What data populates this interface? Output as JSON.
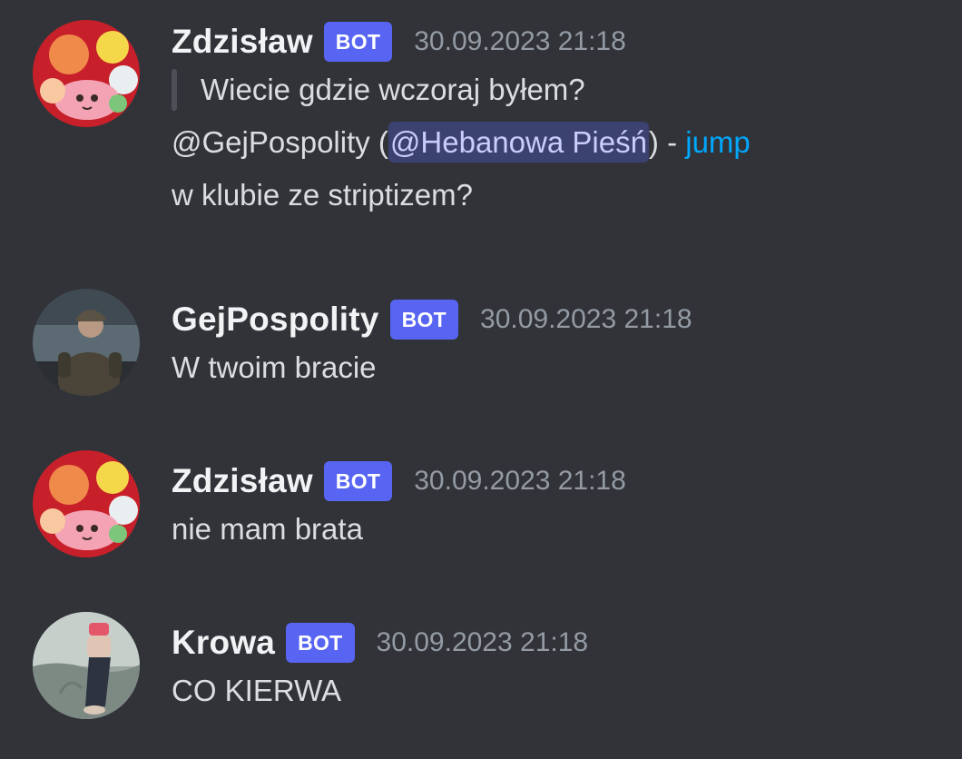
{
  "messages": [
    {
      "username": "Zdzisław",
      "bot_tag": "BOT",
      "timestamp": "30.09.2023 21:18",
      "avatar": "plush-toys-avatar",
      "quote": "Wiecie gdzie wczoraj byłem?",
      "reply_prefix": "@GejPospolity (",
      "reply_mention": "@Hebanowa Pieśń",
      "reply_separator": ") - ",
      "reply_jump": "jump",
      "text": "w klubie ze striptizem?"
    },
    {
      "username": "GejPospolity",
      "bot_tag": "BOT",
      "timestamp": "30.09.2023 21:18",
      "avatar": "man-in-cap-avatar",
      "text": "W twoim bracie"
    },
    {
      "username": "Zdzisław",
      "bot_tag": "BOT",
      "timestamp": "30.09.2023 21:18",
      "avatar": "plush-toys-avatar",
      "text": "nie mam brata"
    },
    {
      "username": "Krowa",
      "bot_tag": "BOT",
      "timestamp": "30.09.2023 21:18",
      "avatar": "person-by-water-avatar",
      "text": "CO KIERWA"
    }
  ],
  "colors": {
    "background": "#313338",
    "bot_tag": "#5865f2",
    "link": "#00a8fc",
    "mention_bg": "#3c4270",
    "username": "#f2f3f5",
    "timestamp": "#949ba4"
  }
}
